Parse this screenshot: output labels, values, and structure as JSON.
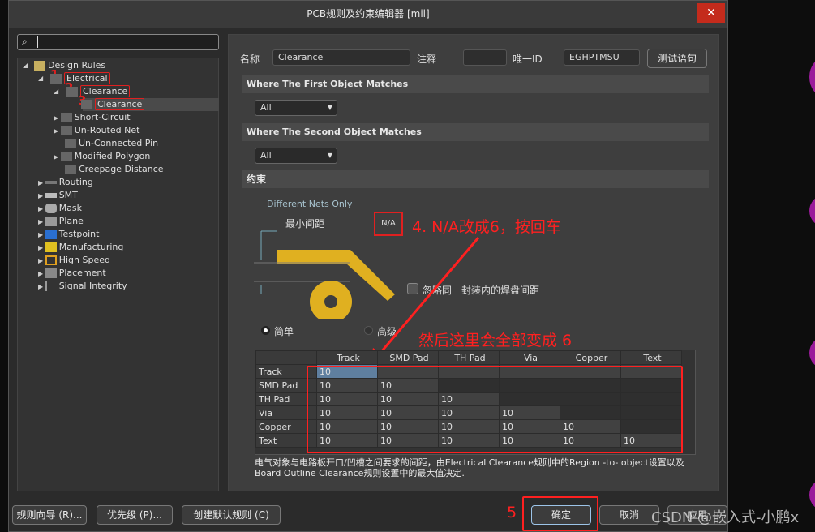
{
  "window": {
    "title": "PCB规则及约束编辑器 [mil]",
    "close_icon": "close-icon"
  },
  "watermark": "CSDN @嵌入式-小鹏x",
  "search": {
    "value": ""
  },
  "tree": {
    "root": "Design Rules",
    "electrical": "Electrical",
    "clearance_group": "Clearance",
    "clearance_rule": "Clearance",
    "electrical_children": [
      "Short-Circuit",
      "Un-Routed Net",
      "Un-Connected Pin",
      "Modified Polygon",
      "Creepage Distance"
    ],
    "categories": [
      "Routing",
      "SMT",
      "Mask",
      "Plane",
      "Testpoint",
      "Manufacturing",
      "High Speed",
      "Placement",
      "Signal Integrity"
    ]
  },
  "rule": {
    "name_label": "名称",
    "name_value": "Clearance",
    "comment_label": "注释",
    "comment_value": "",
    "uid_label": "唯一ID",
    "uid_value": "EGHPTMSU",
    "test_button": "测试语句",
    "first_match": "Where The First Object Matches",
    "first_select": "All",
    "second_match": "Where The Second Object Matches",
    "second_select": "All",
    "constraints": "约束",
    "different_nets": "Different Nets Only",
    "min_clearance_label": "最小间距",
    "min_clearance_value": "N/A",
    "ignore_pads_label": "忽略同一封装内的焊盘间距",
    "ignore_pads_checked": false,
    "mode_simple": "简单",
    "mode_advanced": "高级",
    "mode_selected": "简单",
    "description": "电气对象与电路板开口/凹槽之间要求的间距，由Electrical Clearance规则中的Region -to- object设置以及Board Outline Clearance规则设置中的最大值决定."
  },
  "matrix": {
    "columns": [
      "Track",
      "SMD Pad",
      "TH Pad",
      "Via",
      "Copper",
      "Text"
    ],
    "rows": [
      {
        "label": "Track",
        "values": [
          "10"
        ]
      },
      {
        "label": "SMD Pad",
        "values": [
          "10",
          "10"
        ]
      },
      {
        "label": "TH Pad",
        "values": [
          "10",
          "10",
          "10"
        ]
      },
      {
        "label": "Via",
        "values": [
          "10",
          "10",
          "10",
          "10"
        ]
      },
      {
        "label": "Copper",
        "values": [
          "10",
          "10",
          "10",
          "10",
          "10"
        ]
      },
      {
        "label": "Text",
        "values": [
          "10",
          "10",
          "10",
          "10",
          "10",
          "10"
        ]
      }
    ]
  },
  "annotations": {
    "n1": "1",
    "n2": "2",
    "n3": "3",
    "step4": "4. N/A改成6，按回车",
    "result": "然后这里会全部变成 6",
    "n5": "5"
  },
  "footer": {
    "wizard": "规则向导 (R)...",
    "priority": "优先级 (P)...",
    "create_default": "创建默认规则 (C)",
    "ok": "确定",
    "cancel": "取消",
    "apply": "应用"
  }
}
